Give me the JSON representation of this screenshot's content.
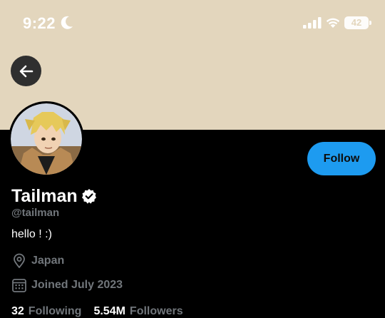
{
  "status_bar": {
    "time": "9:22",
    "battery_level": "42",
    "icons": [
      "moon-icon",
      "signal-icon",
      "wifi-icon",
      "battery-icon"
    ]
  },
  "colors": {
    "banner": "#e3d6bd",
    "background": "#000000",
    "accent": "#1d9bf0",
    "secondary_text": "#71767b"
  },
  "header": {
    "back_icon": "arrow-left-icon"
  },
  "profile": {
    "display_name": "Tailman",
    "verified_icon": "verified-badge-icon",
    "handle": "@tailman",
    "bio": "hello ! :)",
    "location": "Japan",
    "location_icon": "location-pin-icon",
    "joined": "Joined July 2023",
    "joined_icon": "calendar-icon",
    "follow_label": "Follow"
  },
  "stats": {
    "following_count": "32",
    "following_label": "Following",
    "followers_count": "5.54M",
    "followers_label": "Followers"
  }
}
